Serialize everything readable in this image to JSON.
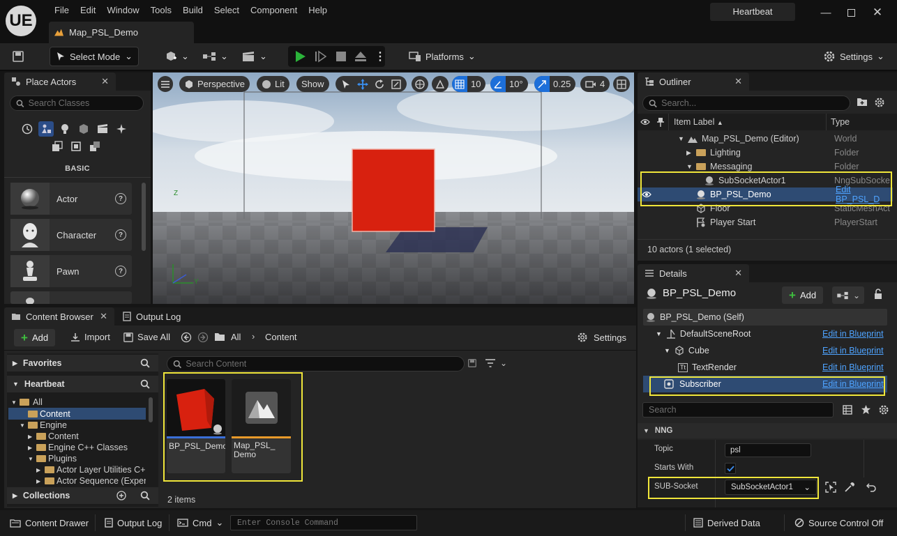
{
  "app": {
    "logo": "UE",
    "project": "Heartbeat",
    "menus": [
      "File",
      "Edit",
      "Window",
      "Tools",
      "Build",
      "Select",
      "Component",
      "Help"
    ],
    "document_tab": "Map_PSL_Demo"
  },
  "toolbar": {
    "select_mode": "Select Mode",
    "platforms": "Platforms",
    "settings": "Settings"
  },
  "place_actors": {
    "title": "Place Actors",
    "search_placeholder": "Search Classes",
    "category": "BASIC",
    "items": [
      {
        "label": "Actor",
        "icon": "sphere-icon"
      },
      {
        "label": "Character",
        "icon": "character-icon"
      },
      {
        "label": "Pawn",
        "icon": "pawn-icon"
      }
    ]
  },
  "viewport": {
    "perspective": "Perspective",
    "lit": "Lit",
    "show": "Show",
    "grid_snap": "10",
    "rot_snap": "10°",
    "scale_snap": "0.25",
    "cam_speed": "4",
    "axis_y": "Y",
    "axis_z": "Z",
    "cube_color": "#d8210f"
  },
  "outliner": {
    "title": "Outliner",
    "search_placeholder": "Search...",
    "col_label": "Item Label",
    "col_type": "Type",
    "rows": [
      {
        "label": "Map_PSL_Demo (Editor)",
        "type": "World"
      },
      {
        "label": "Lighting",
        "type": "Folder"
      },
      {
        "label": "Messaging",
        "type": "Folder"
      },
      {
        "label": "SubSocketActor1",
        "type": "NngSubSocke"
      },
      {
        "label": "BP_PSL_Demo",
        "type": "Edit BP_PSL_D"
      },
      {
        "label": "Floor",
        "type": "StaticMeshAct"
      },
      {
        "label": "Player Start",
        "type": "PlayerStart"
      }
    ],
    "footer": "10 actors (1 selected)"
  },
  "details": {
    "title": "Details",
    "actor_name": "BP_PSL_Demo",
    "add": "Add",
    "components": [
      {
        "label": "BP_PSL_Demo (Self)",
        "link": ""
      },
      {
        "label": "DefaultSceneRoot",
        "link": "Edit in Blueprint"
      },
      {
        "label": "Cube",
        "link": "Edit in Blueprint"
      },
      {
        "label": "TextRender",
        "link": "Edit in Blueprint"
      },
      {
        "label": "Subscriber",
        "link": "Edit in Blueprint"
      }
    ],
    "search_placeholder": "Search",
    "section": "NNG",
    "props": {
      "topic_label": "Topic",
      "topic_value": "psl",
      "starts_with_label": "Starts With",
      "sub_socket_label": "SUB-Socket",
      "sub_socket_value": "SubSocketActor1"
    }
  },
  "content_browser": {
    "title": "Content Browser",
    "output_tab": "Output Log",
    "add": "Add",
    "import": "Import",
    "save_all": "Save All",
    "path_all": "All",
    "path_content": "Content",
    "settings": "Settings",
    "favorites": "Favorites",
    "heartbeat": "Heartbeat",
    "search_placeholder": "Search Content",
    "tree": [
      "All",
      "Content",
      "Engine",
      "Content",
      "Engine C++ Classes",
      "Plugins",
      "Actor Layer Utilities C+",
      "Actor Sequence (Exper"
    ],
    "collections": "Collections",
    "assets": [
      {
        "name": "BP_PSL_Demo",
        "line2": ""
      },
      {
        "name": "Map_PSL_",
        "line2": "Demo"
      }
    ],
    "count": "2 items"
  },
  "status": {
    "content_drawer": "Content Drawer",
    "output_log": "Output Log",
    "cmd": "Cmd",
    "console_placeholder": "Enter Console Command",
    "derived_data": "Derived Data",
    "source_control": "Source Control Off"
  }
}
